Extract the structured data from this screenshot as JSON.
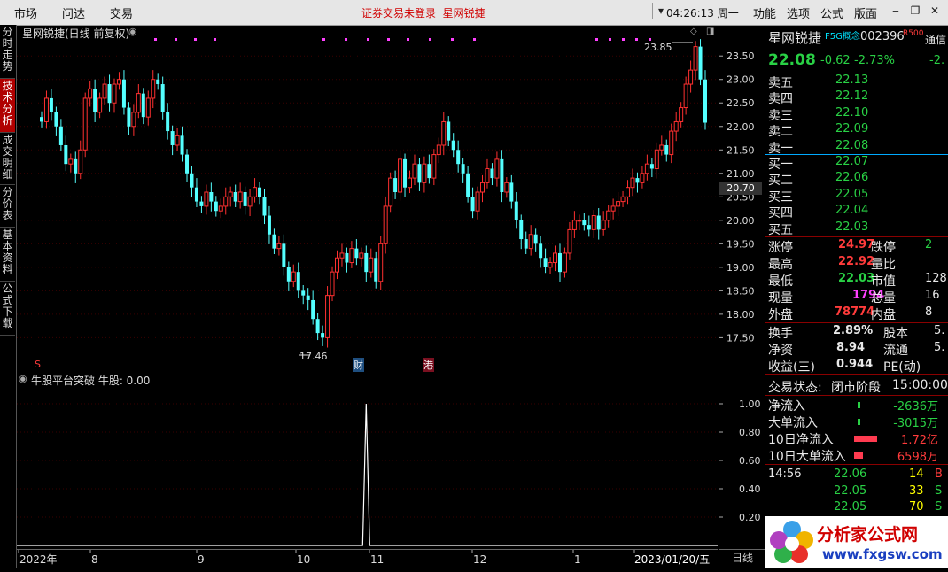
{
  "menu": {
    "market": "市场",
    "wenda": "问达",
    "trade": "交易",
    "status": "证券交易未登录",
    "stock_name_top": "星网锐捷",
    "clock": "04:26:13 周一",
    "func": "功能",
    "options": "选项",
    "formula": "公式",
    "layout": "版面"
  },
  "tabs": [
    "分时走势",
    "技术分析",
    "成交明细",
    "分价表",
    "基本资料",
    "公式下载"
  ],
  "chart": {
    "title": "星网锐捷(日线 前复权)",
    "high_label": "23.85",
    "low_label": "17.46",
    "markers": {
      "s": "S",
      "cai": "财",
      "gang": "港"
    },
    "current_price_tag": "20.70",
    "indicator_title": "牛股平台突破  牛股: 0.00",
    "period": "日线"
  },
  "chart_data": [
    {
      "type": "candlestick",
      "title": "星网锐捷(日线 前复权)",
      "x_labels": [
        "2022年",
        "8",
        "9",
        "10",
        "11",
        "12",
        "1",
        "2023/01/20/五"
      ],
      "ylim": [
        17.3,
        23.9
      ],
      "yticks": [
        17.5,
        18.0,
        18.5,
        19.0,
        19.5,
        20.0,
        20.5,
        21.0,
        21.5,
        22.0,
        22.5,
        23.0,
        23.5
      ],
      "close": [
        22.1,
        22.6,
        22.3,
        22.0,
        21.6,
        21.2,
        21.3,
        21.0,
        21.5,
        22.6,
        22.8,
        22.3,
        22.6,
        22.9,
        22.5,
        22.9,
        23.0,
        22.4,
        22.0,
        22.3,
        22.7,
        22.2,
        22.6,
        23.0,
        22.9,
        22.3,
        21.9,
        21.6,
        21.8,
        21.4,
        21.0,
        20.7,
        20.4,
        20.3,
        20.6,
        20.4,
        20.2,
        20.3,
        20.5,
        20.6,
        20.4,
        20.6,
        20.3,
        20.5,
        20.7,
        20.5,
        20.1,
        19.7,
        19.4,
        19.5,
        19.0,
        18.7,
        18.9,
        18.5,
        18.4,
        18.3,
        17.9,
        17.6,
        17.5,
        18.4,
        18.9,
        19.2,
        19.3,
        19.1,
        19.4,
        19.2,
        19.3,
        18.9,
        19.2,
        18.7,
        19.5,
        20.3,
        20.9,
        20.6,
        21.3,
        20.7,
        20.9,
        21.2,
        20.8,
        21.2,
        20.9,
        21.4,
        21.6,
        22.1,
        21.7,
        21.5,
        21.2,
        21.0,
        20.5,
        20.2,
        20.6,
        20.8,
        21.1,
        20.9,
        21.3,
        20.6,
        20.8,
        20.4,
        20.0,
        19.6,
        19.4,
        19.7,
        19.5,
        19.2,
        19.0,
        19.1,
        19.3,
        18.9,
        19.3,
        19.8,
        20.0,
        20.0,
        19.9,
        19.8,
        20.1,
        19.8,
        20.0,
        20.2,
        20.3,
        20.4,
        20.5,
        20.7,
        20.9,
        20.8,
        21.0,
        21.2,
        21.1,
        21.5,
        21.6,
        21.4,
        21.9,
        22.1,
        22.4,
        22.9,
        23.2,
        23.7,
        23.0,
        22.08
      ],
      "indicator": {
        "name": "牛股",
        "ylim": [
          0,
          1.1
        ],
        "yticks": [
          0.2,
          0.4,
          0.6,
          0.8,
          1.0
        ],
        "spike_index": 67,
        "spike_value": 1.0,
        "current": 0.0
      }
    }
  ],
  "quote": {
    "name": "星网锐捷",
    "tag": "F5G概念",
    "code": "002396",
    "r_badge": "R500",
    "tongxin": "通信",
    "price": "22.08",
    "change": "-0.62",
    "pct": "-2.73%",
    "extra": "-2.",
    "ask": [
      {
        "label": "卖五",
        "price": "22.13"
      },
      {
        "label": "卖四",
        "price": "22.12"
      },
      {
        "label": "卖三",
        "price": "22.10"
      },
      {
        "label": "卖二",
        "price": "22.09"
      },
      {
        "label": "卖一",
        "price": "22.08"
      }
    ],
    "bid": [
      {
        "label": "买一",
        "price": "22.07"
      },
      {
        "label": "买二",
        "price": "22.06"
      },
      {
        "label": "买三",
        "price": "22.05"
      },
      {
        "label": "买四",
        "price": "22.04"
      },
      {
        "label": "买五",
        "price": "22.03"
      }
    ],
    "stats": [
      {
        "l": "涨停",
        "v": "24.97",
        "l2": "跌停",
        "v2": "2"
      },
      {
        "l": "最高",
        "v": "22.92",
        "l2": "量比",
        "v2": ""
      },
      {
        "l": "最低",
        "v": "22.03",
        "l2": "市值",
        "v2": "128"
      },
      {
        "l": "现量",
        "v": "1794",
        "l2": "总量",
        "v2": "16"
      },
      {
        "l": "外盘",
        "v": "78774",
        "l2": "内盘",
        "v2": "8"
      }
    ],
    "stats2": [
      {
        "l": "换手",
        "v": "2.89%",
        "l2": "股本",
        "v2": "5."
      },
      {
        "l": "净资",
        "v": "8.94",
        "l2": "流通",
        "v2": "5."
      },
      {
        "l": "收益(三)",
        "v": "0.944",
        "l2": "PE(动)",
        "v2": ""
      }
    ],
    "trade_status_label": "交易状态:",
    "trade_status": "闭市阶段",
    "trade_time": "15:00:00",
    "flows": [
      {
        "l": "净流入",
        "v": "-2636万"
      },
      {
        "l": "大单流入",
        "v": "-3015万"
      },
      {
        "l": "10日净流入",
        "v": "1.72亿"
      },
      {
        "l": "10日大单流入",
        "v": "6598万"
      }
    ],
    "ticks": [
      {
        "time": "14:56",
        "price": "22.06",
        "vol": "14",
        "side": "B"
      },
      {
        "time": "",
        "price": "22.05",
        "vol": "33",
        "side": "S"
      },
      {
        "time": "",
        "price": "22.05",
        "vol": "70",
        "side": "S"
      }
    ],
    "logo_text": "分析家公式网",
    "logo_url": "www.fxgsw.com"
  }
}
